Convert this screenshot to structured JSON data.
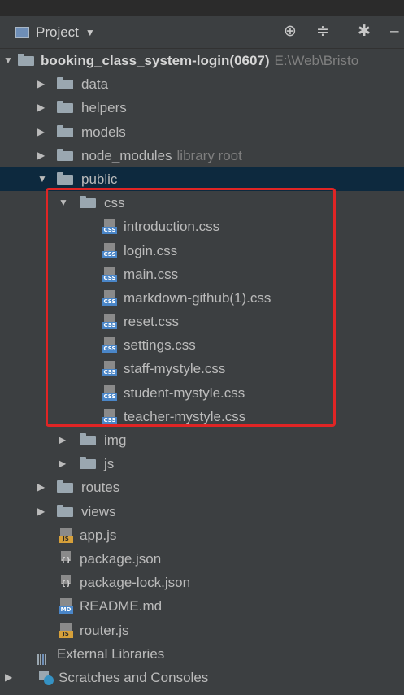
{
  "header": {
    "title": "Project",
    "icons": [
      "crosshair-icon",
      "collapse-icon",
      "gear-icon",
      "minimize-icon"
    ]
  },
  "colors": {
    "background": "#3c3f41",
    "selected_row": "#0d293e",
    "highlight_border": "#e02525",
    "folder": "#9aa7b0",
    "css_badge": "#4a86c8",
    "js_badge": "#d6a03a"
  },
  "tree": {
    "root": {
      "label": "booking_class_system-login(0607)",
      "path": "E:\\Web\\Bristo"
    },
    "data": "data",
    "helpers": "helpers",
    "models": "models",
    "node_modules": {
      "label": "node_modules",
      "hint": "library root"
    },
    "public": "public",
    "css": "css",
    "css_files": [
      "introduction.css",
      "login.css",
      "main.css",
      "markdown-github(1).css",
      "reset.css",
      "settings.css",
      "staff-mystyle.css",
      "student-mystyle.css",
      "teacher-mystyle.css"
    ],
    "img": "img",
    "js": "js",
    "routes": "routes",
    "views": "views",
    "files": [
      {
        "label": "app.js",
        "badge": "JS"
      },
      {
        "label": "package.json",
        "badge": "{}"
      },
      {
        "label": "package-lock.json",
        "badge": "{}"
      },
      {
        "label": "README.md",
        "badge": "MD"
      },
      {
        "label": "router.js",
        "badge": "JS"
      }
    ],
    "external_libraries": "External Libraries",
    "scratches": "Scratches and Consoles"
  },
  "badges": {
    "css": "CSS"
  }
}
